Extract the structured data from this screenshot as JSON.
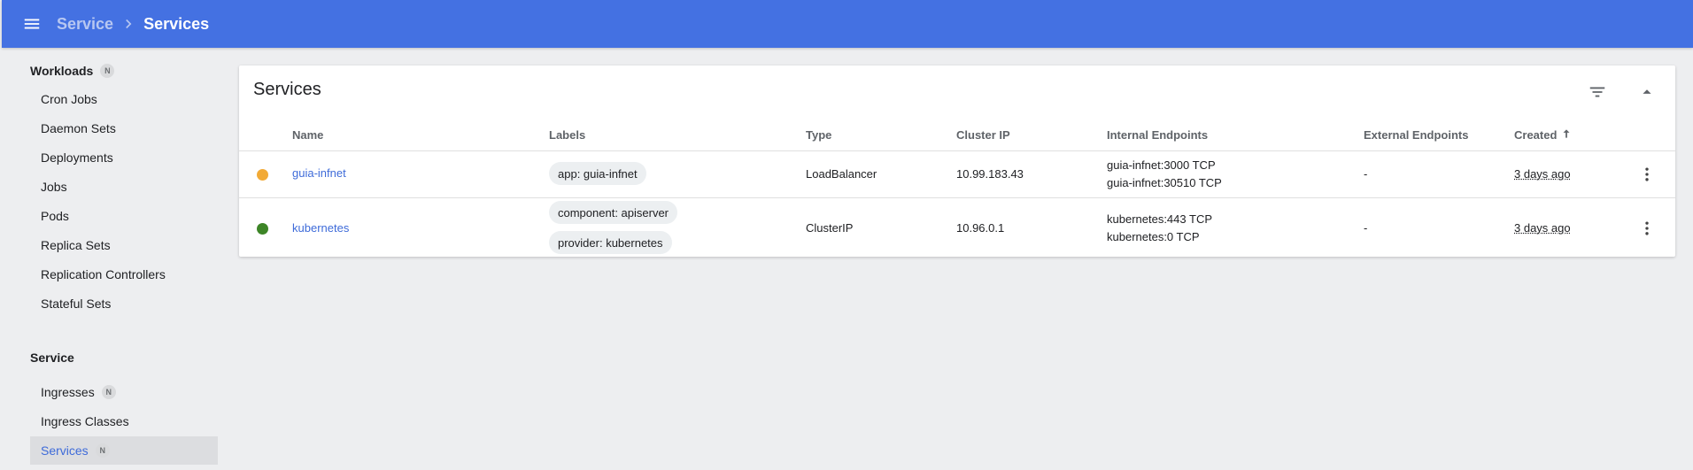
{
  "header": {
    "breadcrumb_parent": "Service",
    "breadcrumb_current": "Services",
    "bg_color": "#4471e2"
  },
  "sidebar": {
    "workloads_label": "Workloads",
    "workloads_badge": "N",
    "workload_items": [
      "Cron Jobs",
      "Daemon Sets",
      "Deployments",
      "Jobs",
      "Pods",
      "Replica Sets",
      "Replication Controllers",
      "Stateful Sets"
    ],
    "service_label": "Service",
    "service_items": [
      {
        "label": "Ingresses",
        "badge": "N"
      },
      {
        "label": "Ingress Classes"
      },
      {
        "label": "Services",
        "badge": "N",
        "active": true
      }
    ]
  },
  "card": {
    "title": "Services",
    "columns": [
      "Name",
      "Labels",
      "Type",
      "Cluster IP",
      "Internal Endpoints",
      "External Endpoints",
      "Created"
    ],
    "rows": [
      {
        "status_color": "#f2aa36",
        "name": "guia-infnet",
        "labels": [
          "app: guia-infnet"
        ],
        "type": "LoadBalancer",
        "cluster_ip": "10.99.183.43",
        "internal_endpoints": [
          "guia-infnet:3000 TCP",
          "guia-infnet:30510 TCP"
        ],
        "external_endpoints": "-",
        "created": "3 days ago"
      },
      {
        "status_color": "#3d8527",
        "name": "kubernetes",
        "labels": [
          "component: apiserver",
          "provider: kubernetes"
        ],
        "type": "ClusterIP",
        "cluster_ip": "10.96.0.1",
        "internal_endpoints": [
          "kubernetes:443 TCP",
          "kubernetes:0 TCP"
        ],
        "external_endpoints": "-",
        "created": "3 days ago"
      }
    ]
  }
}
